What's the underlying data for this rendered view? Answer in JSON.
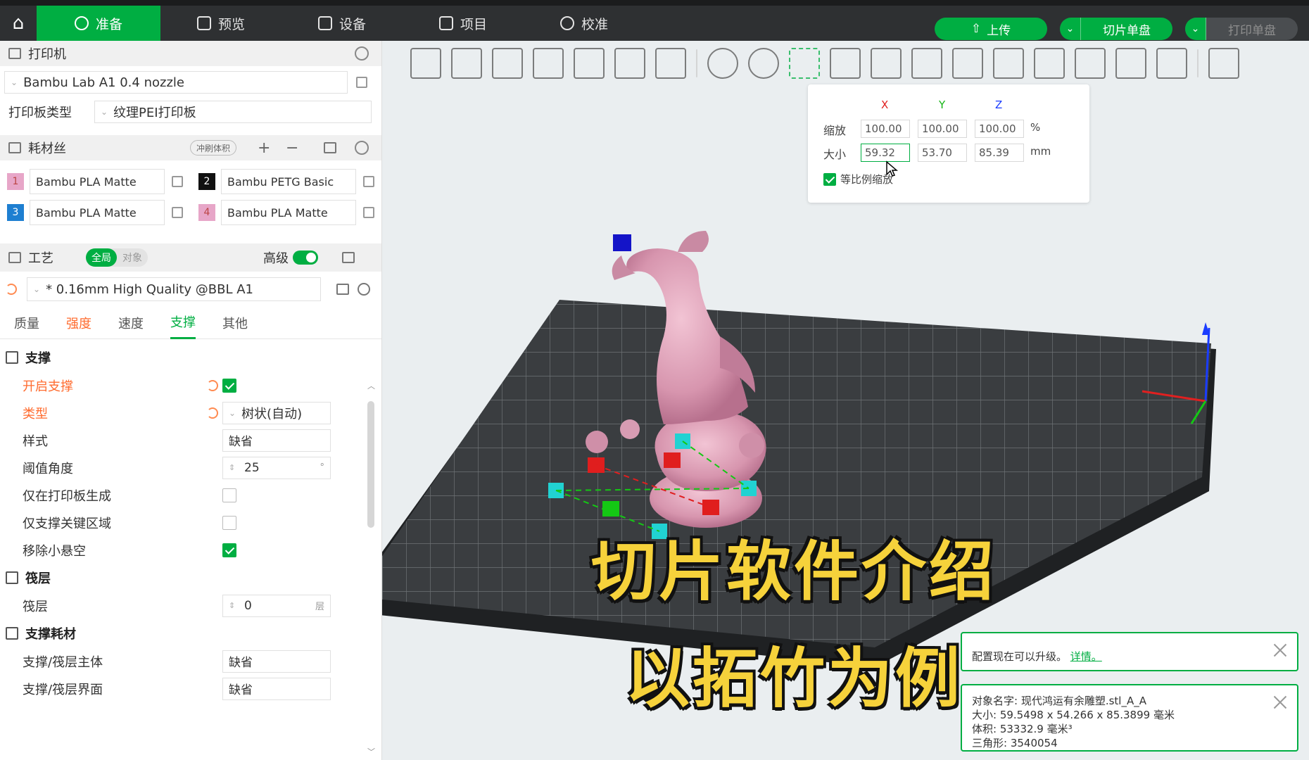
{
  "topbar": {
    "tabs": [
      {
        "label": "准备",
        "icon": "cube-icon"
      },
      {
        "label": "预览",
        "icon": "layers-icon"
      },
      {
        "label": "设备",
        "icon": "device-icon"
      },
      {
        "label": "项目",
        "icon": "project-icon"
      },
      {
        "label": "校准",
        "icon": "calibrate-icon"
      }
    ],
    "upload_label": "上传",
    "slice_label": "切片单盘",
    "print_label": "打印单盘"
  },
  "printer": {
    "section_title": "打印机",
    "printer_name": "Bambu Lab A1 0.4 nozzle",
    "plate_type_label": "打印板类型",
    "plate_type_value": "纹理PEI打印板"
  },
  "filament": {
    "section_title": "耗材丝",
    "flush_label": "冲刷体积",
    "items": [
      {
        "index": "1",
        "name": "Bambu PLA Matte",
        "color": "#e7a6c8"
      },
      {
        "index": "2",
        "name": "Bambu PETG Basic",
        "color": "#111111"
      },
      {
        "index": "3",
        "name": "Bambu PLA Matte",
        "color": "#1e7fd1"
      },
      {
        "index": "4",
        "name": "Bambu PLA Matte",
        "color": "#e7a6c8"
      }
    ]
  },
  "process": {
    "section_title": "工艺",
    "seg_global": "全局",
    "seg_object": "对象",
    "advanced_label": "高级",
    "preset": "* 0.16mm High Quality @BBL A1",
    "subtabs": [
      "质量",
      "强度",
      "速度",
      "支撑",
      "其他"
    ]
  },
  "support": {
    "group_title": "支撑",
    "enable_label": "开启支撑",
    "type_label": "类型",
    "type_value": "树状(自动)",
    "style_label": "样式",
    "style_value": "缺省",
    "threshold_label": "阈值角度",
    "threshold_value": "25",
    "threshold_unit": "°",
    "on_plate_only_label": "仅在打印板生成",
    "critical_only_label": "仅支撑关键区域",
    "remove_overhang_label": "移除小悬空"
  },
  "raft": {
    "group_title": "筏层",
    "raft_label": "筏层",
    "raft_value": "0",
    "raft_unit": "层"
  },
  "support_filament": {
    "group_title": "支撑耗材",
    "base_label": "支撑/筏层主体",
    "base_value": "缺省",
    "interface_label": "支撑/筏层界面",
    "interface_value": "缺省"
  },
  "scale_popup": {
    "axis_x": "X",
    "axis_y": "Y",
    "axis_z": "Z",
    "scale_label": "缩放",
    "scale_x": "100.00",
    "scale_y": "100.00",
    "scale_z": "100.00",
    "scale_unit": "%",
    "size_label": "大小",
    "size_x": "59.32",
    "size_y": "53.70",
    "size_z": "85.39",
    "size_unit": "mm",
    "uniform_label": "等比例缩放"
  },
  "overlay": {
    "line1": "切片软件介绍",
    "line2": "以拓竹为例"
  },
  "notices": {
    "upgrade_text": "配置现在可以升级。",
    "upgrade_link": "详情。",
    "object_name": "对象名字: 现代鸿运有余雕塑.stl_A_A",
    "object_size": "大小: 59.5498 x 54.266 x 85.3899 毫米",
    "object_volume": "体积: 53332.9 毫米³",
    "object_triangles": "三角形: 3540054"
  },
  "colors": {
    "accent": "#00ae42",
    "orange": "#ff6b2e",
    "model": "#d9a0b5"
  }
}
